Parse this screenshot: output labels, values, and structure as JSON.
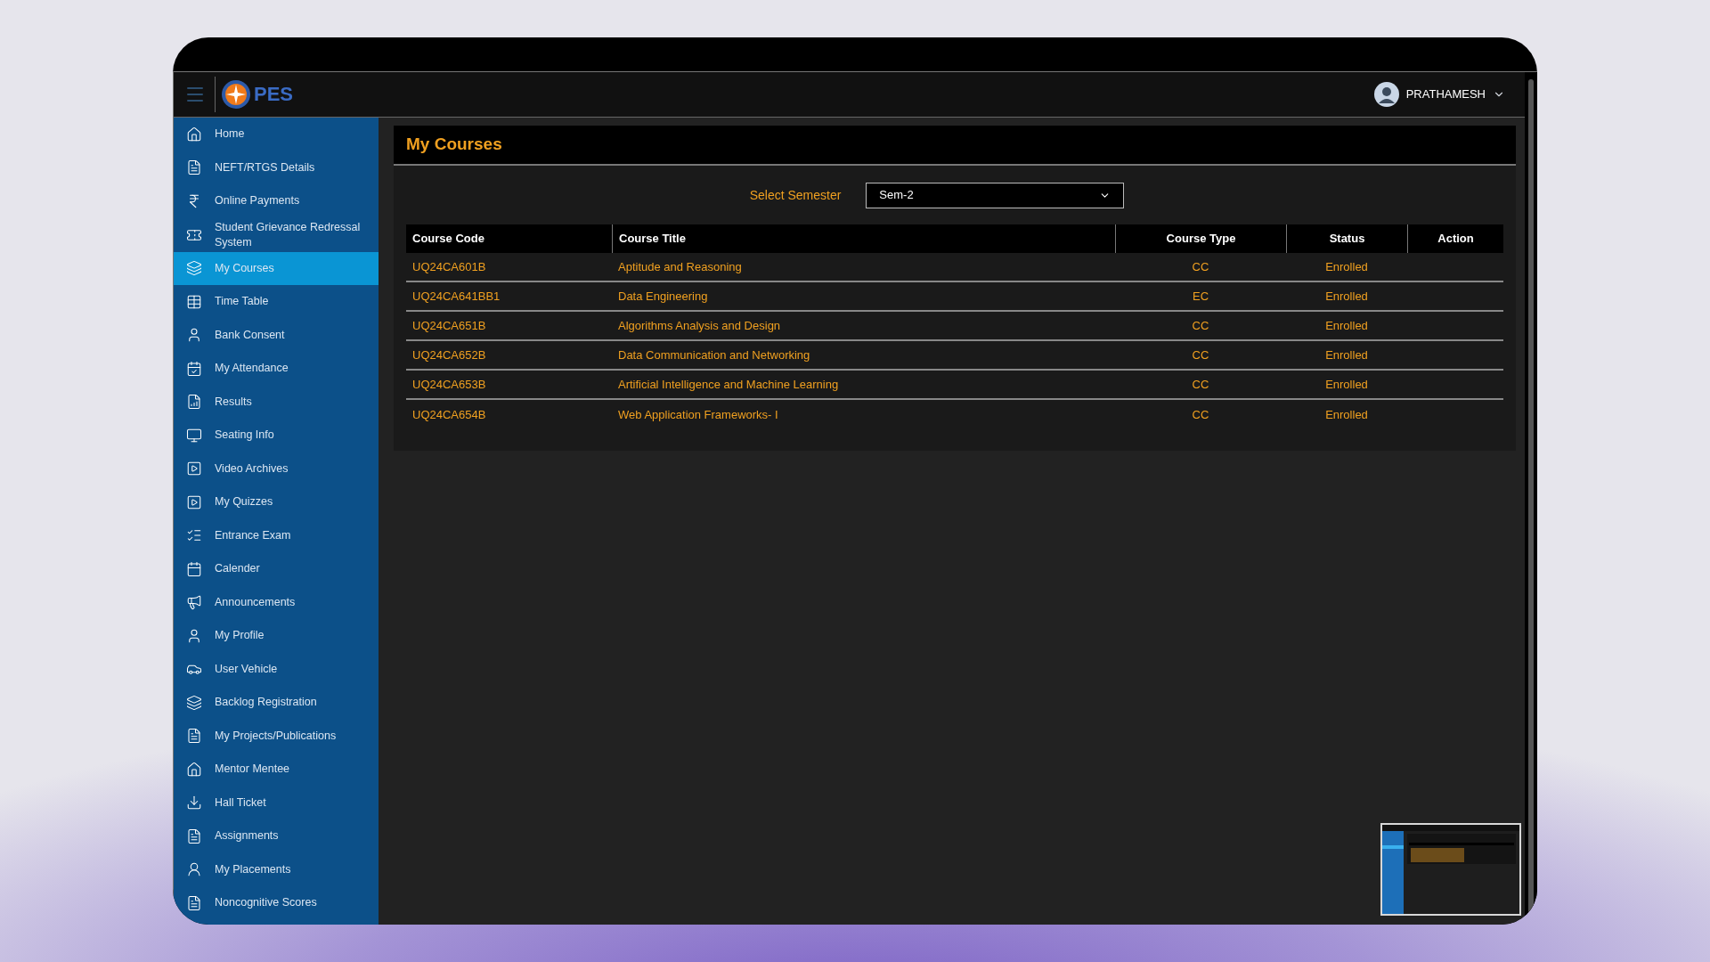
{
  "header": {
    "logo_text": "PES",
    "user_name": "PRATHAMESH"
  },
  "sidebar": {
    "items": [
      {
        "label": "Home",
        "selected": false
      },
      {
        "label": "NEFT/RTGS Details",
        "selected": false
      },
      {
        "label": "Online Payments",
        "selected": false
      },
      {
        "label": "Student Grievance Redressal System",
        "selected": false
      },
      {
        "label": "My Courses",
        "selected": true
      },
      {
        "label": "Time Table",
        "selected": false
      },
      {
        "label": "Bank Consent",
        "selected": false
      },
      {
        "label": "My Attendance",
        "selected": false
      },
      {
        "label": "Results",
        "selected": false
      },
      {
        "label": "Seating Info",
        "selected": false
      },
      {
        "label": "Video Archives",
        "selected": false
      },
      {
        "label": "My Quizzes",
        "selected": false
      },
      {
        "label": "Entrance Exam",
        "selected": false
      },
      {
        "label": "Calender",
        "selected": false
      },
      {
        "label": "Announcements",
        "selected": false
      },
      {
        "label": "My Profile",
        "selected": false
      },
      {
        "label": "User Vehicle",
        "selected": false
      },
      {
        "label": "Backlog Registration",
        "selected": false
      },
      {
        "label": "My Projects/Publications",
        "selected": false
      },
      {
        "label": "Mentor Mentee",
        "selected": false
      },
      {
        "label": "Hall Ticket",
        "selected": false
      },
      {
        "label": "Assignments",
        "selected": false
      },
      {
        "label": "My Placements",
        "selected": false
      },
      {
        "label": "Noncognitive Scores",
        "selected": false
      }
    ]
  },
  "page": {
    "title": "My Courses",
    "semester_label": "Select Semester",
    "semester_value": "Sem-2"
  },
  "table": {
    "columns": [
      "Course Code",
      "Course Title",
      "Course Type",
      "Status",
      "Action"
    ],
    "rows": [
      {
        "code": "UQ24CA601B",
        "title": "Aptitude and Reasoning",
        "type": "CC",
        "status": "Enrolled"
      },
      {
        "code": "UQ24CA641BB1",
        "title": "Data Engineering",
        "type": "EC",
        "status": "Enrolled"
      },
      {
        "code": "UQ24CA651B",
        "title": "Algorithms Analysis and Design",
        "type": "CC",
        "status": "Enrolled"
      },
      {
        "code": "UQ24CA652B",
        "title": "Data Communication and Networking",
        "type": "CC",
        "status": "Enrolled"
      },
      {
        "code": "UQ24CA653B",
        "title": "Artificial Intelligence and Machine Learning",
        "type": "CC",
        "status": "Enrolled"
      },
      {
        "code": "UQ24CA654B",
        "title": "Web Application Frameworks- I",
        "type": "CC",
        "status": "Enrolled"
      }
    ]
  }
}
